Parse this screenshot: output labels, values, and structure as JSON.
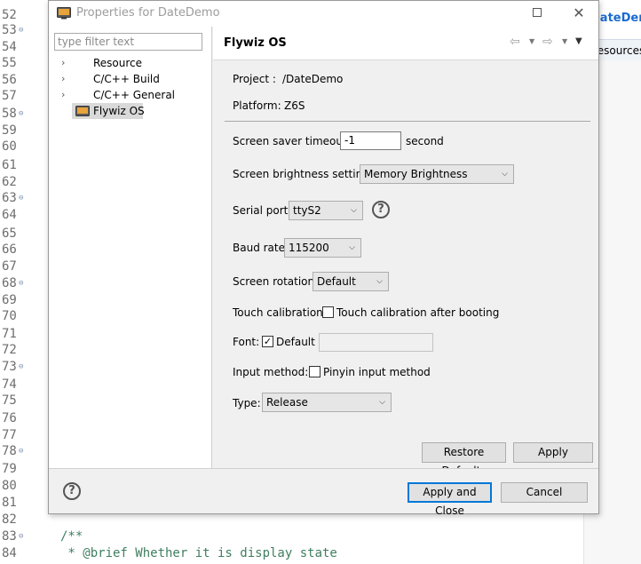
{
  "editor": {
    "line_numbers": [
      "52",
      "53",
      "54",
      "55",
      "56",
      "57",
      "58",
      "59",
      "60",
      "61",
      "62",
      "63",
      "64",
      "65",
      "66",
      "67",
      "68",
      "69",
      "70",
      "71",
      "72",
      "73",
      "74",
      "75",
      "76",
      "77",
      "78",
      "79",
      "80",
      "81",
      "82",
      "83",
      "84"
    ],
    "code_lines": [
      "/**",
      " * @brief Whether it is display state"
    ],
    "tab_label": "DateDemo",
    "tab2_label": "Resources"
  },
  "dialog": {
    "title": "Properties for DateDemo",
    "filter_placeholder": "type filter text",
    "tree": [
      {
        "label": "Resource",
        "expandable": true
      },
      {
        "label": "C/C++ Build",
        "expandable": true
      },
      {
        "label": "C/C++ General",
        "expandable": true
      },
      {
        "label": "Flywiz OS",
        "expandable": false,
        "selected": true
      }
    ],
    "page_title": "Flywiz OS",
    "nav": {
      "back": "⇦",
      "forward": "⇨",
      "menu": "▼",
      "caret": "▼"
    },
    "project_label": "Project :",
    "project_value": "/DateDemo",
    "platform_label": "Platform:",
    "platform_value": "Z6S",
    "screen_saver_label": "Screen saver timeout:",
    "screen_saver_value": "-1",
    "screen_saver_unit": "second",
    "brightness_label": "Screen brightness setting:",
    "brightness_value": "Memory Brightness",
    "serial_label": "Serial port:",
    "serial_value": "ttyS2",
    "baud_label": "Baud rate:",
    "baud_value": "115200",
    "rotation_label": "Screen rotation:",
    "rotation_value": "Default",
    "touch_label": "Touch calibration:",
    "touch_checkbox_label": "Touch calibration after booting",
    "touch_checked": false,
    "font_label": "Font:",
    "font_checkbox_label": "Default",
    "font_checked": true,
    "font_value": "",
    "input_label": "Input method:",
    "input_checkbox_label": "Pinyin input method",
    "input_checked": false,
    "type_label": "Type:",
    "type_value": "Release",
    "restore_label": "Restore Defaults",
    "apply_label": "Apply",
    "apply_close_label": "Apply and Close",
    "cancel_label": "Cancel",
    "help_glyph": "?",
    "check_glyph": "✓",
    "chevron_glyph": "⌵"
  },
  "colors": {
    "accent": "#0078d7",
    "comment": "#3f7f5f",
    "link": "#1a6bcf"
  },
  "icons": [
    "app-icon",
    "maximize-icon",
    "close-icon",
    "expand-arrow-icon",
    "flywiz-icon",
    "back-icon",
    "forward-icon",
    "view-menu-icon",
    "help-icon",
    "chevron-down-icon",
    "checkbox-icon"
  ]
}
